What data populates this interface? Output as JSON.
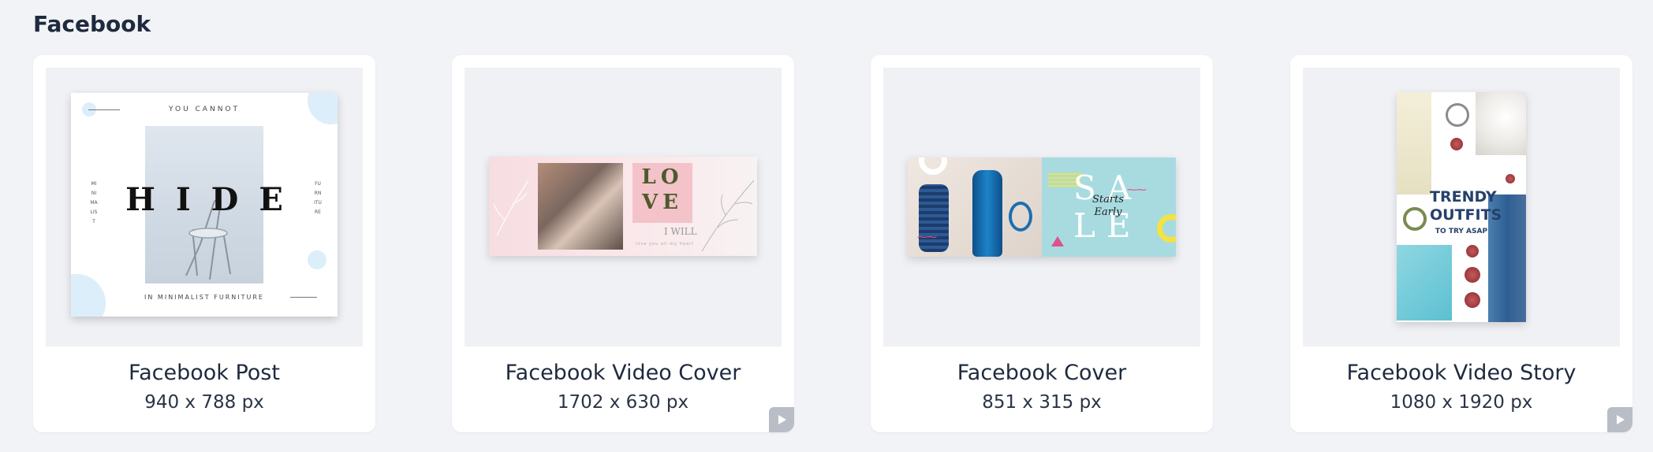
{
  "section": {
    "title": "Facebook"
  },
  "cards": [
    {
      "name": "Facebook Post",
      "size": "940 x 788 px",
      "is_video": false,
      "thumbnail": {
        "top_text": "YOU CANNOT",
        "headline": "HIDE",
        "bottom_text": "IN MINIMALIST FURNITURE",
        "left_vertical": "MINIMALIST",
        "right_vertical": "FURNITURE"
      }
    },
    {
      "name": "Facebook Video Cover",
      "size": "1702 x 630 px",
      "is_video": true,
      "thumbnail": {
        "headline": "LO VE",
        "subtext": "I WILL",
        "small_text": "love you all my heart"
      }
    },
    {
      "name": "Facebook Cover",
      "size": "851 x 315 px",
      "is_video": false,
      "thumbnail": {
        "sale_top": "SA",
        "sale_bottom": "LE",
        "tagline": "Starts Early"
      }
    },
    {
      "name": "Facebook Video Story",
      "size": "1080 x 1920 px",
      "is_video": true,
      "thumbnail": {
        "headline": "TRENDY OUTFITS",
        "subtext": "TO TRY ASAP"
      }
    }
  ],
  "icons": {
    "video_badge": "play-icon"
  },
  "colors": {
    "page_background": "#f2f3f6",
    "card_background": "#ffffff",
    "text_primary": "#1e2a3e",
    "video_badge": "#b8bdc6"
  }
}
